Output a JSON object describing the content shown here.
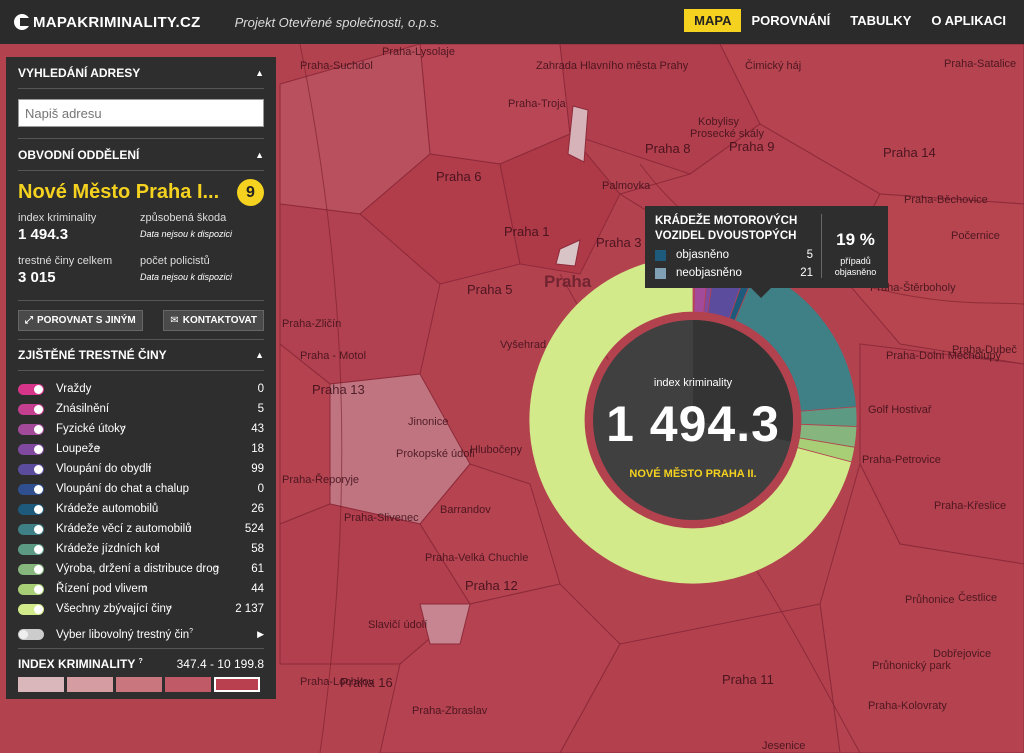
{
  "header": {
    "logo": "MAPAKRIMINALITY.CZ",
    "tagline": "Projekt Otevřené společnosti, o.p.s.",
    "nav": [
      {
        "label": "MAPA",
        "active": true
      },
      {
        "label": "POROVNÁNÍ",
        "active": false
      },
      {
        "label": "TABULKY",
        "active": false
      },
      {
        "label": "O APLIKACI",
        "active": false
      }
    ]
  },
  "panel": {
    "search_title": "VYHLEDÁNÍ ADRESY",
    "search_placeholder": "Napiš adresu",
    "district_title": "OBVODNÍ ODDĚLENÍ",
    "district_name": "Nové Město Praha I...",
    "district_rank": "9",
    "stats": {
      "index_label": "index kriminality",
      "index_value": "1 494.3",
      "damage_label": "způsobená škoda",
      "damage_value": "Data nejsou k dispozici",
      "total_label": "trestné činy celkem",
      "total_value": "3 015",
      "police_label": "počet policistů",
      "police_value": "Data nejsou k dispozici"
    },
    "compare_button": "POROVNAT S JINÝM",
    "contact_button": "KONTAKTOVAT",
    "crimes_title": "ZJIŠTĚNÉ TRESTNÉ ČINY",
    "crimes": [
      {
        "name": "Vraždy",
        "value": "0",
        "color": "#d6358a",
        "help": false
      },
      {
        "name": "Znásilnění",
        "value": "5",
        "color": "#c43f8f",
        "help": false
      },
      {
        "name": "Fyzické útoky",
        "value": "43",
        "color": "#a44a9b",
        "help": true
      },
      {
        "name": "Loupeže",
        "value": "18",
        "color": "#7f4aa0",
        "help": true
      },
      {
        "name": "Vloupání do obydlí",
        "value": "99",
        "color": "#5c4c9e",
        "help": true
      },
      {
        "name": "Vloupání do chat a chalup",
        "value": "0",
        "color": "#2f4f8f",
        "help": false
      },
      {
        "name": "Krádeže automobilů",
        "value": "26",
        "color": "#1e5a7c",
        "help": false
      },
      {
        "name": "Krádeže věcí z automobilů",
        "value": "524",
        "color": "#3f7f86",
        "help": true
      },
      {
        "name": "Krádeže jízdních kol",
        "value": "58",
        "color": "#5c9a83",
        "help": true
      },
      {
        "name": "Výroba, držení a distribuce drog",
        "value": "61",
        "color": "#86b57d",
        "help": true
      },
      {
        "name": "Řízení pod vlivem",
        "value": "44",
        "color": "#a8cf75",
        "help": true
      },
      {
        "name": "Všechny zbývající činy",
        "value": "2 137",
        "color": "#d2ea8a",
        "help": true
      }
    ],
    "select_any": "Vyber libovolný trestný čin",
    "index_title": "INDEX KRIMINALITY",
    "index_range": "347.4 - 10 199.8",
    "legend_colors": [
      "#d9b7bb",
      "#d59ca2",
      "#c9767f",
      "#c05a67",
      "#b8404f"
    ]
  },
  "donut": {
    "title": "index kriminality",
    "value": "1 494.3",
    "district": "NOVÉ MĚSTO PRAHA II."
  },
  "tooltip": {
    "title": "KRÁDEŽE MOTOROVÝCH VOZIDEL DVOUSTOPÝCH",
    "solved_label": "objasněno",
    "solved_value": "5",
    "solved_color": "#1e5a7c",
    "unsolved_label": "neobjasněno",
    "unsolved_value": "21",
    "unsolved_color": "#7fa0b5",
    "percent": "19 %",
    "percent_sub_1": "případů",
    "percent_sub_2": "objasněno"
  },
  "map": {
    "labels": [
      {
        "text": "Praha-Lysolaje",
        "big": false
      },
      {
        "text": "Zahrada Hlavního města Prahy",
        "big": false
      },
      {
        "text": "Praha-Troja",
        "big": false
      },
      {
        "text": "Praha-Suchdol",
        "big": false
      },
      {
        "text": "Čimický háj",
        "big": false
      },
      {
        "text": "Praha 6",
        "big": true
      },
      {
        "text": "Praha 8",
        "big": true
      },
      {
        "text": "Praha 9",
        "big": true
      },
      {
        "text": "Praha 14",
        "big": true
      },
      {
        "text": "Praha 1",
        "big": true
      },
      {
        "text": "Praha 3",
        "big": true
      },
      {
        "text": "Praha",
        "big": false
      },
      {
        "text": "Praha 5",
        "big": true
      },
      {
        "text": "Praha 13",
        "big": true
      },
      {
        "text": "Praha 12",
        "big": true
      },
      {
        "text": "Praha 16",
        "big": true
      },
      {
        "text": "Praha 11",
        "big": true
      },
      {
        "text": "Praha-Zbraslav",
        "big": false
      },
      {
        "text": "Praha-Lochkov",
        "big": false
      },
      {
        "text": "Praha-Slivenec",
        "big": false
      },
      {
        "text": "Praha-Velká Chuchle",
        "big": false
      },
      {
        "text": "Praha-Řeporyje",
        "big": false
      },
      {
        "text": "Praha-Štěrboholy",
        "big": false
      },
      {
        "text": "Praha-Dolní Měcholupy",
        "big": false
      },
      {
        "text": "Praha-Dubeč",
        "big": false
      },
      {
        "text": "Praha-Petrovice",
        "big": false
      },
      {
        "text": "Praha-Křeslice",
        "big": false
      },
      {
        "text": "Průhonice",
        "big": false
      },
      {
        "text": "Čestlice",
        "big": false
      },
      {
        "text": "Průhonický park",
        "big": false
      },
      {
        "text": "Dobřejovice",
        "big": false
      },
      {
        "text": "Golf Hostivař",
        "big": false
      },
      {
        "text": "Praha-Satalice",
        "big": false
      },
      {
        "text": "Praha-Běchovice",
        "big": false
      },
      {
        "text": "Počernice",
        "big": false
      },
      {
        "text": "Vyšehrad",
        "big": false
      },
      {
        "text": "Praha-Kolovraty",
        "big": false
      },
      {
        "text": "Slavičí údolí",
        "big": false
      },
      {
        "text": "Jesenice",
        "big": false
      },
      {
        "text": "Praha-Zličín",
        "big": false
      },
      {
        "text": "Praha - Motol",
        "big": false
      },
      {
        "text": "Prokopské údolí",
        "big": false
      },
      {
        "text": "Jinonice",
        "big": false
      },
      {
        "text": "Kobylisy",
        "big": false
      },
      {
        "text": "Prosecké skály",
        "big": false
      },
      {
        "text": "Palmovka",
        "big": false
      },
      {
        "text": "Barrandov",
        "big": false
      },
      {
        "text": "Hlubočepy",
        "big": false
      }
    ]
  }
}
